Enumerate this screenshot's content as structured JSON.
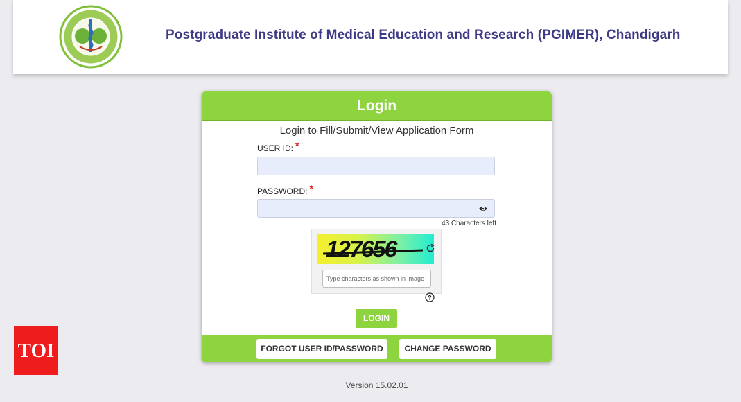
{
  "header": {
    "title": "Postgraduate Institute of Medical Education and Research (PGIMER), Chandigarh"
  },
  "login_card": {
    "heading": "Login",
    "subtitle": "Login to Fill/Submit/View Application Form",
    "user_id_label": "USER ID:",
    "password_label": "PASSWORD:",
    "required_mark": "*",
    "user_id_value": "",
    "password_value": "",
    "chars_left": "43 Characters left",
    "captcha": {
      "code": "127656",
      "placeholder": "Type characters as shown in image"
    },
    "login_button": "LOGIN",
    "forgot_button": "FORGOT USER ID/PASSWORD",
    "change_password_button": "CHANGE PASSWORD"
  },
  "footer": {
    "version": "Version 15.02.01"
  },
  "watermark": {
    "label": "TOI"
  },
  "colors": {
    "accent": "#8dd43f",
    "title": "#3d3a86",
    "required": "#e02020",
    "watermark": "#ee1c1c"
  },
  "icons": [
    "institute-logo-icon",
    "eye-icon",
    "refresh-icon",
    "help-icon"
  ]
}
